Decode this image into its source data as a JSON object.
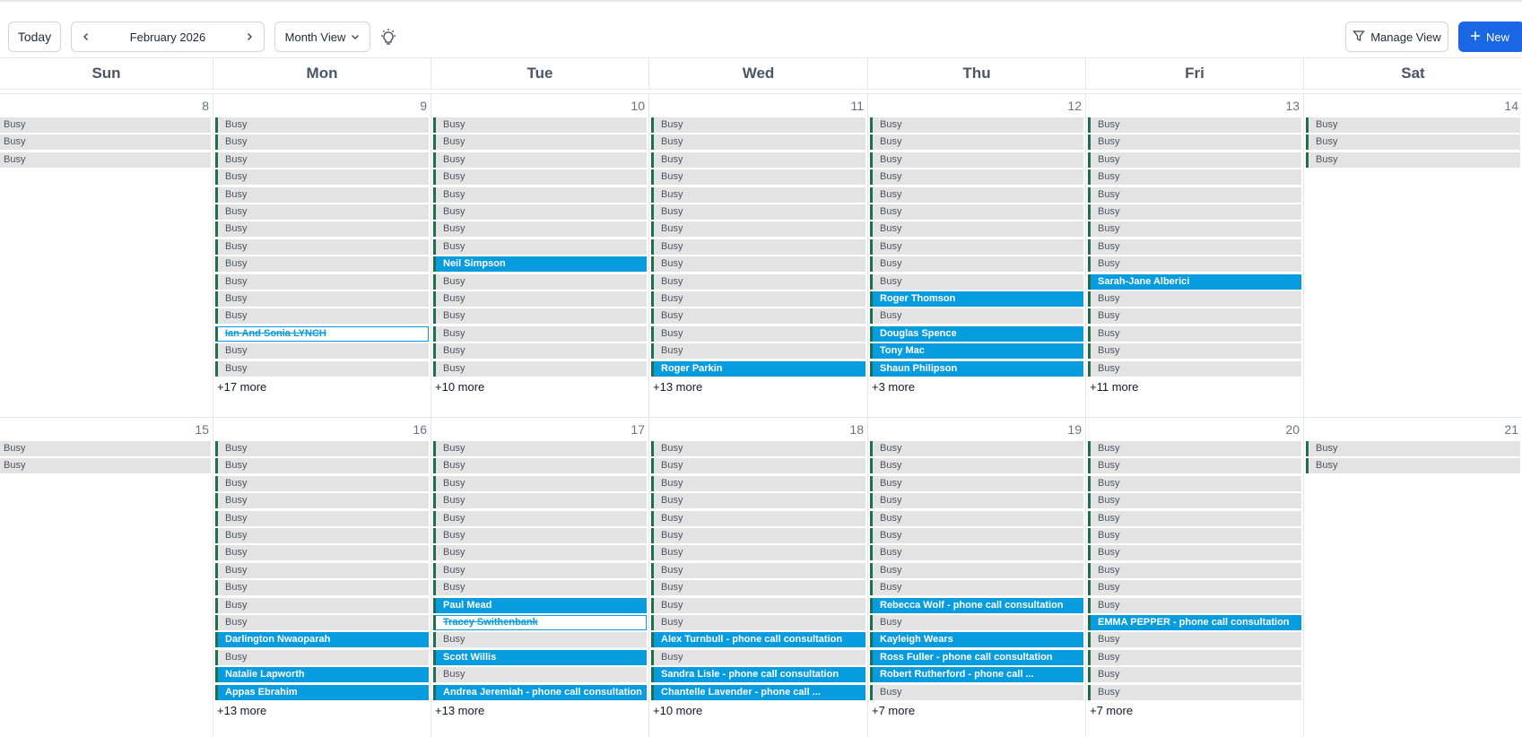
{
  "toolbar": {
    "today_label": "Today",
    "current_month": "February 2026",
    "view_label": "Month View",
    "manage_view_label": "Manage View",
    "new_label": "New"
  },
  "weekdays": [
    "Sun",
    "Mon",
    "Tue",
    "Wed",
    "Thu",
    "Fri",
    "Sat"
  ],
  "weeks": [
    {
      "days": [
        {
          "num": "8",
          "events": [
            [
              "b",
              "Busy"
            ],
            [
              "b",
              "Busy"
            ],
            [
              "b",
              "Busy"
            ]
          ],
          "more": ""
        },
        {
          "num": "9",
          "events": [
            [
              "b",
              "Busy"
            ],
            [
              "b",
              "Busy"
            ],
            [
              "b",
              "Busy"
            ],
            [
              "b",
              "Busy"
            ],
            [
              "b",
              "Busy"
            ],
            [
              "b",
              "Busy"
            ],
            [
              "b",
              "Busy"
            ],
            [
              "b",
              "Busy"
            ],
            [
              "b",
              "Busy"
            ],
            [
              "b",
              "Busy"
            ],
            [
              "b",
              "Busy"
            ],
            [
              "b",
              "Busy"
            ],
            [
              "c",
              "Ian And Sonia LYNCH"
            ],
            [
              "b",
              "Busy"
            ],
            [
              "b",
              "Busy"
            ]
          ],
          "more": "+17 more"
        },
        {
          "num": "10",
          "events": [
            [
              "b",
              "Busy"
            ],
            [
              "b",
              "Busy"
            ],
            [
              "b",
              "Busy"
            ],
            [
              "b",
              "Busy"
            ],
            [
              "b",
              "Busy"
            ],
            [
              "b",
              "Busy"
            ],
            [
              "b",
              "Busy"
            ],
            [
              "b",
              "Busy"
            ],
            [
              "a",
              "Neil Simpson"
            ],
            [
              "b",
              "Busy"
            ],
            [
              "b",
              "Busy"
            ],
            [
              "b",
              "Busy"
            ],
            [
              "b",
              "Busy"
            ],
            [
              "b",
              "Busy"
            ],
            [
              "b",
              "Busy"
            ]
          ],
          "more": "+10 more"
        },
        {
          "num": "11",
          "events": [
            [
              "b",
              "Busy"
            ],
            [
              "b",
              "Busy"
            ],
            [
              "b",
              "Busy"
            ],
            [
              "b",
              "Busy"
            ],
            [
              "b",
              "Busy"
            ],
            [
              "b",
              "Busy"
            ],
            [
              "b",
              "Busy"
            ],
            [
              "b",
              "Busy"
            ],
            [
              "b",
              "Busy"
            ],
            [
              "b",
              "Busy"
            ],
            [
              "b",
              "Busy"
            ],
            [
              "b",
              "Busy"
            ],
            [
              "b",
              "Busy"
            ],
            [
              "b",
              "Busy"
            ],
            [
              "a",
              "Roger Parkin"
            ]
          ],
          "more": "+13 more"
        },
        {
          "num": "12",
          "events": [
            [
              "b",
              "Busy"
            ],
            [
              "b",
              "Busy"
            ],
            [
              "b",
              "Busy"
            ],
            [
              "b",
              "Busy"
            ],
            [
              "b",
              "Busy"
            ],
            [
              "b",
              "Busy"
            ],
            [
              "b",
              "Busy"
            ],
            [
              "b",
              "Busy"
            ],
            [
              "b",
              "Busy"
            ],
            [
              "b",
              "Busy"
            ],
            [
              "a",
              "Roger Thomson"
            ],
            [
              "b",
              "Busy"
            ],
            [
              "a",
              "Douglas Spence"
            ],
            [
              "a",
              "Tony Mac"
            ],
            [
              "a",
              "Shaun Philipson"
            ]
          ],
          "more": "+3 more"
        },
        {
          "num": "13",
          "events": [
            [
              "b",
              "Busy"
            ],
            [
              "b",
              "Busy"
            ],
            [
              "b",
              "Busy"
            ],
            [
              "b",
              "Busy"
            ],
            [
              "b",
              "Busy"
            ],
            [
              "b",
              "Busy"
            ],
            [
              "b",
              "Busy"
            ],
            [
              "b",
              "Busy"
            ],
            [
              "b",
              "Busy"
            ],
            [
              "a",
              "Sarah-Jane Alberici"
            ],
            [
              "b",
              "Busy"
            ],
            [
              "b",
              "Busy"
            ],
            [
              "b",
              "Busy"
            ],
            [
              "b",
              "Busy"
            ],
            [
              "b",
              "Busy"
            ]
          ],
          "more": "+11 more"
        },
        {
          "num": "14",
          "events": [
            [
              "b",
              "Busy"
            ],
            [
              "b",
              "Busy"
            ],
            [
              "b",
              "Busy"
            ]
          ],
          "more": ""
        }
      ]
    },
    {
      "days": [
        {
          "num": "15",
          "events": [
            [
              "b",
              "Busy"
            ],
            [
              "b",
              "Busy"
            ]
          ],
          "more": ""
        },
        {
          "num": "16",
          "events": [
            [
              "b",
              "Busy"
            ],
            [
              "b",
              "Busy"
            ],
            [
              "b",
              "Busy"
            ],
            [
              "b",
              "Busy"
            ],
            [
              "b",
              "Busy"
            ],
            [
              "b",
              "Busy"
            ],
            [
              "b",
              "Busy"
            ],
            [
              "b",
              "Busy"
            ],
            [
              "b",
              "Busy"
            ],
            [
              "b",
              "Busy"
            ],
            [
              "b",
              "Busy"
            ],
            [
              "a",
              "Darlington Nwaoparah"
            ],
            [
              "b",
              "Busy"
            ],
            [
              "a",
              "Natalie Lapworth"
            ],
            [
              "a",
              "Appas Ebrahim"
            ]
          ],
          "more": "+13 more"
        },
        {
          "num": "17",
          "events": [
            [
              "b",
              "Busy"
            ],
            [
              "b",
              "Busy"
            ],
            [
              "b",
              "Busy"
            ],
            [
              "b",
              "Busy"
            ],
            [
              "b",
              "Busy"
            ],
            [
              "b",
              "Busy"
            ],
            [
              "b",
              "Busy"
            ],
            [
              "b",
              "Busy"
            ],
            [
              "b",
              "Busy"
            ],
            [
              "a",
              "Paul Mead"
            ],
            [
              "c",
              "Tracey Swithenbank"
            ],
            [
              "b",
              "Busy"
            ],
            [
              "a",
              "Scott Willis"
            ],
            [
              "b",
              "Busy"
            ],
            [
              "a",
              "Andrea Jeremiah - phone call consultation"
            ]
          ],
          "more": "+13 more"
        },
        {
          "num": "18",
          "events": [
            [
              "b",
              "Busy"
            ],
            [
              "b",
              "Busy"
            ],
            [
              "b",
              "Busy"
            ],
            [
              "b",
              "Busy"
            ],
            [
              "b",
              "Busy"
            ],
            [
              "b",
              "Busy"
            ],
            [
              "b",
              "Busy"
            ],
            [
              "b",
              "Busy"
            ],
            [
              "b",
              "Busy"
            ],
            [
              "b",
              "Busy"
            ],
            [
              "b",
              "Busy"
            ],
            [
              "a",
              "Alex Turnbull - phone call consultation"
            ],
            [
              "b",
              "Busy"
            ],
            [
              "a",
              "Sandra Lisle - phone call consultation"
            ],
            [
              "a",
              "Chantelle Lavender - phone call ..."
            ]
          ],
          "more": "+10 more"
        },
        {
          "num": "19",
          "events": [
            [
              "b",
              "Busy"
            ],
            [
              "b",
              "Busy"
            ],
            [
              "b",
              "Busy"
            ],
            [
              "b",
              "Busy"
            ],
            [
              "b",
              "Busy"
            ],
            [
              "b",
              "Busy"
            ],
            [
              "b",
              "Busy"
            ],
            [
              "b",
              "Busy"
            ],
            [
              "b",
              "Busy"
            ],
            [
              "a",
              "Rebecca Wolf - phone call consultation"
            ],
            [
              "b",
              "Busy"
            ],
            [
              "a",
              "Kayleigh Wears"
            ],
            [
              "a",
              "Ross Fuller - phone call consultation"
            ],
            [
              "a",
              "Robert Rutherford - phone call ..."
            ],
            [
              "b",
              "Busy"
            ]
          ],
          "more": "+7 more"
        },
        {
          "num": "20",
          "events": [
            [
              "b",
              "Busy"
            ],
            [
              "b",
              "Busy"
            ],
            [
              "b",
              "Busy"
            ],
            [
              "b",
              "Busy"
            ],
            [
              "b",
              "Busy"
            ],
            [
              "b",
              "Busy"
            ],
            [
              "b",
              "Busy"
            ],
            [
              "b",
              "Busy"
            ],
            [
              "b",
              "Busy"
            ],
            [
              "b",
              "Busy"
            ],
            [
              "a",
              "EMMA PEPPER - phone call consultation"
            ],
            [
              "b",
              "Busy"
            ],
            [
              "b",
              "Busy"
            ],
            [
              "b",
              "Busy"
            ],
            [
              "b",
              "Busy"
            ]
          ],
          "more": "+7 more"
        },
        {
          "num": "21",
          "events": [
            [
              "b",
              "Busy"
            ],
            [
              "b",
              "Busy"
            ]
          ],
          "more": ""
        }
      ]
    }
  ],
  "colors": {
    "appointment": "#079be0",
    "busy": "#e3e3e3",
    "accent_bar": "#1f6f4a",
    "new_button": "#1a66e5"
  }
}
